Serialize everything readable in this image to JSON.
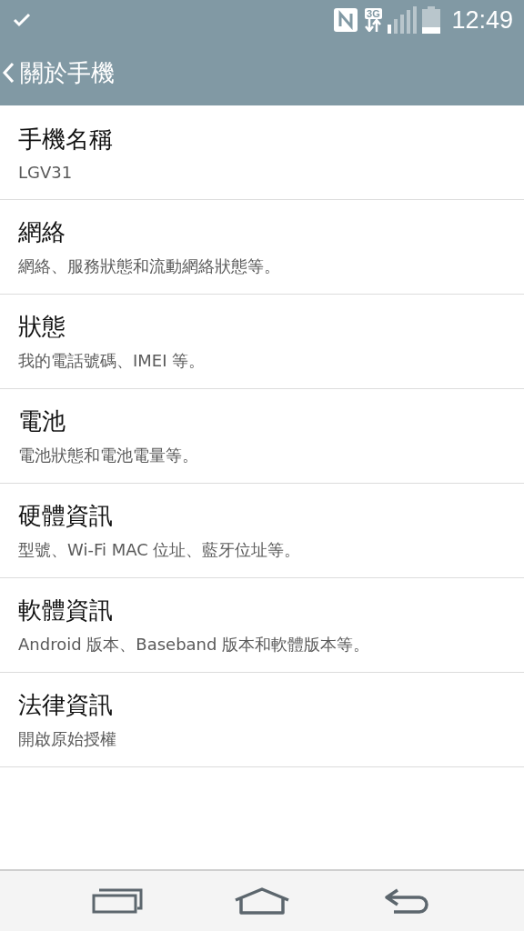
{
  "status_bar": {
    "network": "3G",
    "time": "12:49"
  },
  "header": {
    "title": "關於手機"
  },
  "items": [
    {
      "title": "手機名稱",
      "subtitle": "LGV31"
    },
    {
      "title": "網絡",
      "subtitle": "網絡、服務狀態和流動網絡狀態等。"
    },
    {
      "title": "狀態",
      "subtitle": "我的電話號碼、IMEI 等。"
    },
    {
      "title": "電池",
      "subtitle": "電池狀態和電池電量等。"
    },
    {
      "title": "硬體資訊",
      "subtitle": "型號、Wi-Fi MAC 位址、藍牙位址等。"
    },
    {
      "title": "軟體資訊",
      "subtitle": "Android 版本、Baseband 版本和軟體版本等。"
    },
    {
      "title": "法律資訊",
      "subtitle": "開啟原始授權"
    }
  ]
}
